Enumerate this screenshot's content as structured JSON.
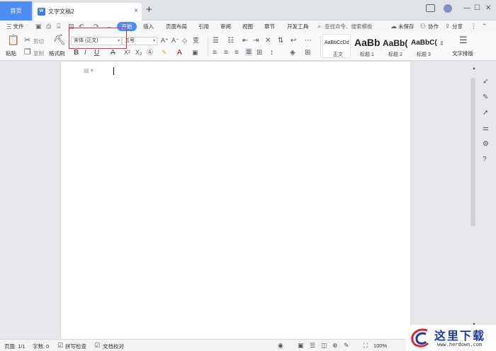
{
  "titlebar": {
    "home_tab": "首页",
    "doc_tab": "文字文稿2",
    "doc_icon": "W",
    "close": "×",
    "new_tab": "+",
    "avatar": "",
    "win_min": "—",
    "win_max": "☐",
    "win_close": "✕"
  },
  "menubar": {
    "file": "三 文件",
    "items": [
      "插入",
      "页面布局",
      "引用",
      "审阅",
      "视图",
      "章节",
      "开发工具"
    ],
    "active": "开始",
    "search": "查找命令、搜索模板",
    "unsaved": "未保存",
    "collab": "协作",
    "share": "分享"
  },
  "ribbon": {
    "paste": "粘贴",
    "cut": "剪切",
    "copy": "复制",
    "format_painter": "格式刷",
    "font_family": "宋体 (正文)",
    "font_size": "五号",
    "bold": "B",
    "italic": "I",
    "underline": "U",
    "strike": "A",
    "styles": [
      {
        "preview": "AaBbCcDd",
        "name": "正文"
      },
      {
        "preview": "AaBb",
        "name": "标题 1"
      },
      {
        "preview": "AaBb(",
        "name": "标题 2"
      },
      {
        "preview": "AaBbC(",
        "name": "标题 3"
      }
    ],
    "text_layout": "文字排版"
  },
  "status": {
    "page": "页面: 1/1",
    "words": "字数: 0",
    "spell": "拼写检查",
    "proof": "文档校对",
    "zoom": "100%"
  },
  "watermark": {
    "title": "这里下载",
    "url": "www.herdown.com"
  },
  "colors": {
    "accent": "#4e8cf5",
    "red_box": "#e0373c"
  }
}
